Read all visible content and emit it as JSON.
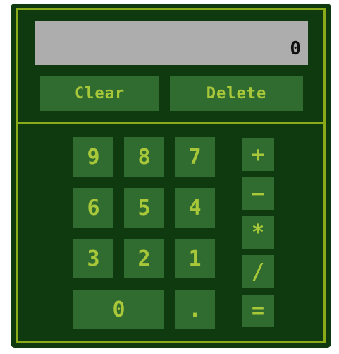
{
  "display": {
    "value": "0"
  },
  "controls": {
    "clear_label": "Clear",
    "delete_label": "Delete"
  },
  "keys": {
    "k9": "9",
    "k8": "8",
    "k7": "7",
    "k6": "6",
    "k5": "5",
    "k4": "4",
    "k3": "3",
    "k2": "2",
    "k1": "1",
    "k0": "0",
    "dot": "."
  },
  "operators": {
    "add": "+",
    "subtract": "−",
    "multiply": "*",
    "divide": "/",
    "equals": "="
  },
  "colors": {
    "body": "#0f3a0f",
    "border": "#8aaa1a",
    "key_bg": "#306b30",
    "key_text": "#a8c83a",
    "display_bg": "#adadad",
    "display_text": "#111111"
  }
}
